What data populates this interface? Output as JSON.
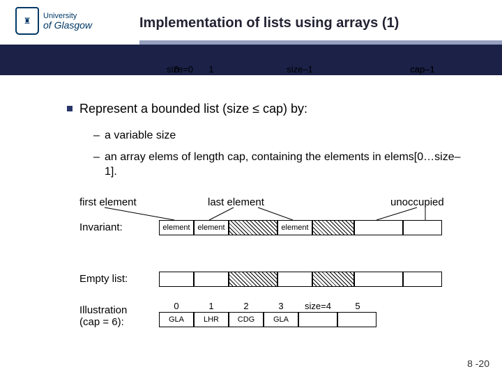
{
  "logo": {
    "line1": "University",
    "line2": "of Glasgow"
  },
  "title": "Implementation of lists using arrays (1)",
  "bullets": {
    "main": "Represent a bounded list (size ≤ cap) by:",
    "sub1": "a variable size",
    "sub2": "an array elems of length cap, containing the elements in elems[0…size–1]."
  },
  "labels": {
    "first": "first element",
    "last": "last element",
    "unoccupied": "unoccupied",
    "invariant": "Invariant:",
    "empty": "Empty list:",
    "illustration_l1": "Illustration",
    "illustration_l2": "(cap = 6):"
  },
  "invariant_row": {
    "idx0": "0",
    "idx1": "1",
    "idx_size": "size–1",
    "idx_cap": "cap–1",
    "cell": "element"
  },
  "empty_row": {
    "idx_size": "size=0",
    "idx_cap": "cap–1"
  },
  "illustration_row": {
    "indices": [
      "0",
      "1",
      "2",
      "3",
      "size=4",
      "5"
    ],
    "values": [
      "GLA",
      "LHR",
      "CDG",
      "GLA",
      "",
      ""
    ]
  },
  "footer": "8 -20"
}
